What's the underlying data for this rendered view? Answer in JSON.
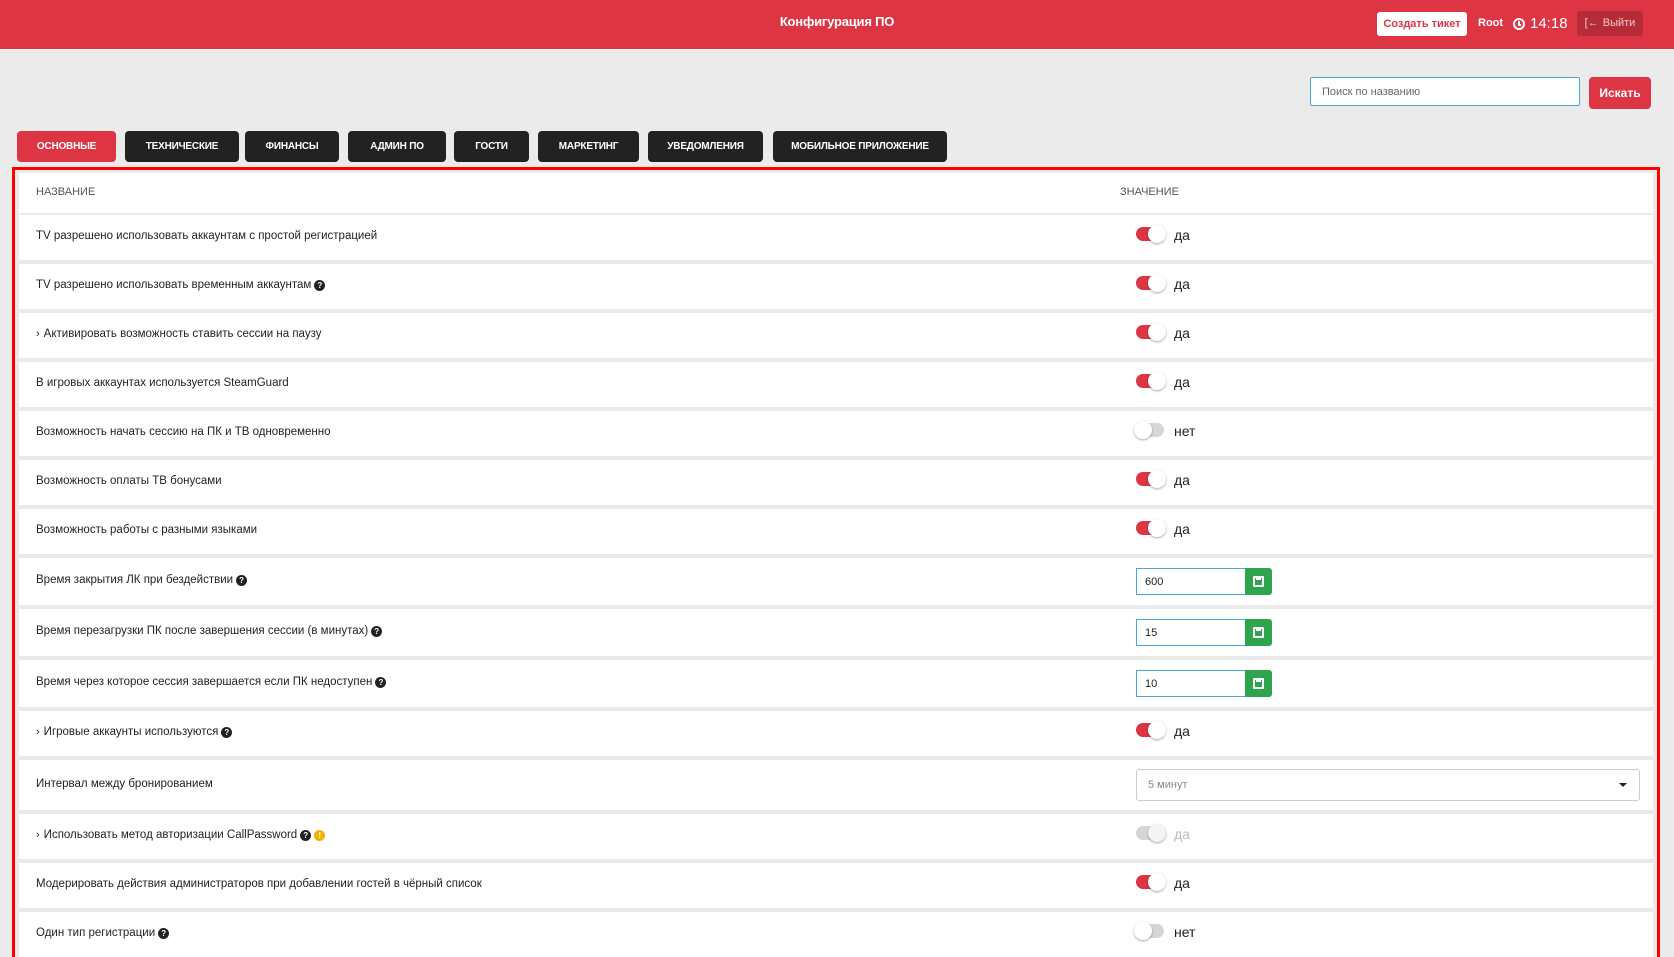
{
  "header": {
    "title": "Конфигурация ПО",
    "create_ticket": "Создать тикет",
    "user": "Root",
    "time": "14:18",
    "logout": "Выйти"
  },
  "search": {
    "placeholder": "Поиск по названию",
    "button": "Искать"
  },
  "tabs": [
    {
      "label": "ОСНОВНЫЕ",
      "active": true
    },
    {
      "label": "ТЕХНИЧЕСКИЕ",
      "active": false
    },
    {
      "label": "ФИНАНСЫ",
      "active": false
    },
    {
      "label": "АДМИН ПО",
      "active": false
    },
    {
      "label": "ГОСТИ",
      "active": false
    },
    {
      "label": "МАРКЕТИНГ",
      "active": false
    },
    {
      "label": "УВЕДОМЛЕНИЯ",
      "active": false
    },
    {
      "label": "МОБИЛЬНОЕ ПРИЛОЖЕНИЕ",
      "active": false
    }
  ],
  "table": {
    "col_name": "НАЗВАНИЕ",
    "col_value": "ЗНАЧЕНИЕ",
    "rows": [
      {
        "label": "TV разрешено использовать аккаунтам с простой регистрацией",
        "type": "toggle",
        "on": true,
        "value": "да"
      },
      {
        "label": "TV разрешено использовать временным аккаунтам",
        "help": true,
        "type": "toggle",
        "on": true,
        "value": "да"
      },
      {
        "label": "Активировать возможность ставить сессии на паузу",
        "expandable": true,
        "type": "toggle",
        "on": true,
        "value": "да"
      },
      {
        "label": "В игровых аккаунтах используется SteamGuard",
        "type": "toggle",
        "on": true,
        "value": "да"
      },
      {
        "label": "Возможность начать сессию на ПК и ТВ одновременно",
        "type": "toggle",
        "on": false,
        "value": "нет"
      },
      {
        "label": "Возможность оплаты ТВ бонусами",
        "type": "toggle",
        "on": true,
        "value": "да"
      },
      {
        "label": "Возможность работы с разными языками",
        "type": "toggle",
        "on": true,
        "value": "да"
      },
      {
        "label": "Время закрытия ЛК при бездействии",
        "help": true,
        "type": "number",
        "value": "600"
      },
      {
        "label": "Время перезагрузки ПК после завершения сессии (в минутах)",
        "help": true,
        "type": "number",
        "value": "15"
      },
      {
        "label": "Время через которое сессия завершается если ПК недоступен",
        "help": true,
        "type": "number",
        "value": "10"
      },
      {
        "label": "Игровые аккаунты используются",
        "expandable": true,
        "help": true,
        "type": "toggle",
        "on": true,
        "value": "да"
      },
      {
        "label": "Интервал между бронированием",
        "type": "select",
        "value": "5 минут"
      },
      {
        "label": "Использовать метод авторизации CallPassword",
        "expandable": true,
        "help": true,
        "warn": true,
        "type": "toggle",
        "on": true,
        "disabled": true,
        "value": "да"
      },
      {
        "label": "Модерировать действия администраторов при добавлении гостей в чёрный список",
        "type": "toggle",
        "on": true,
        "value": "да"
      },
      {
        "label": "Один тип регистрации",
        "help": true,
        "type": "toggle",
        "on": false,
        "value": "нет"
      }
    ]
  },
  "colors": {
    "accent": "#de3545",
    "dark": "#222222",
    "save": "#2ea44f",
    "highlight_border": "#ff0000"
  }
}
